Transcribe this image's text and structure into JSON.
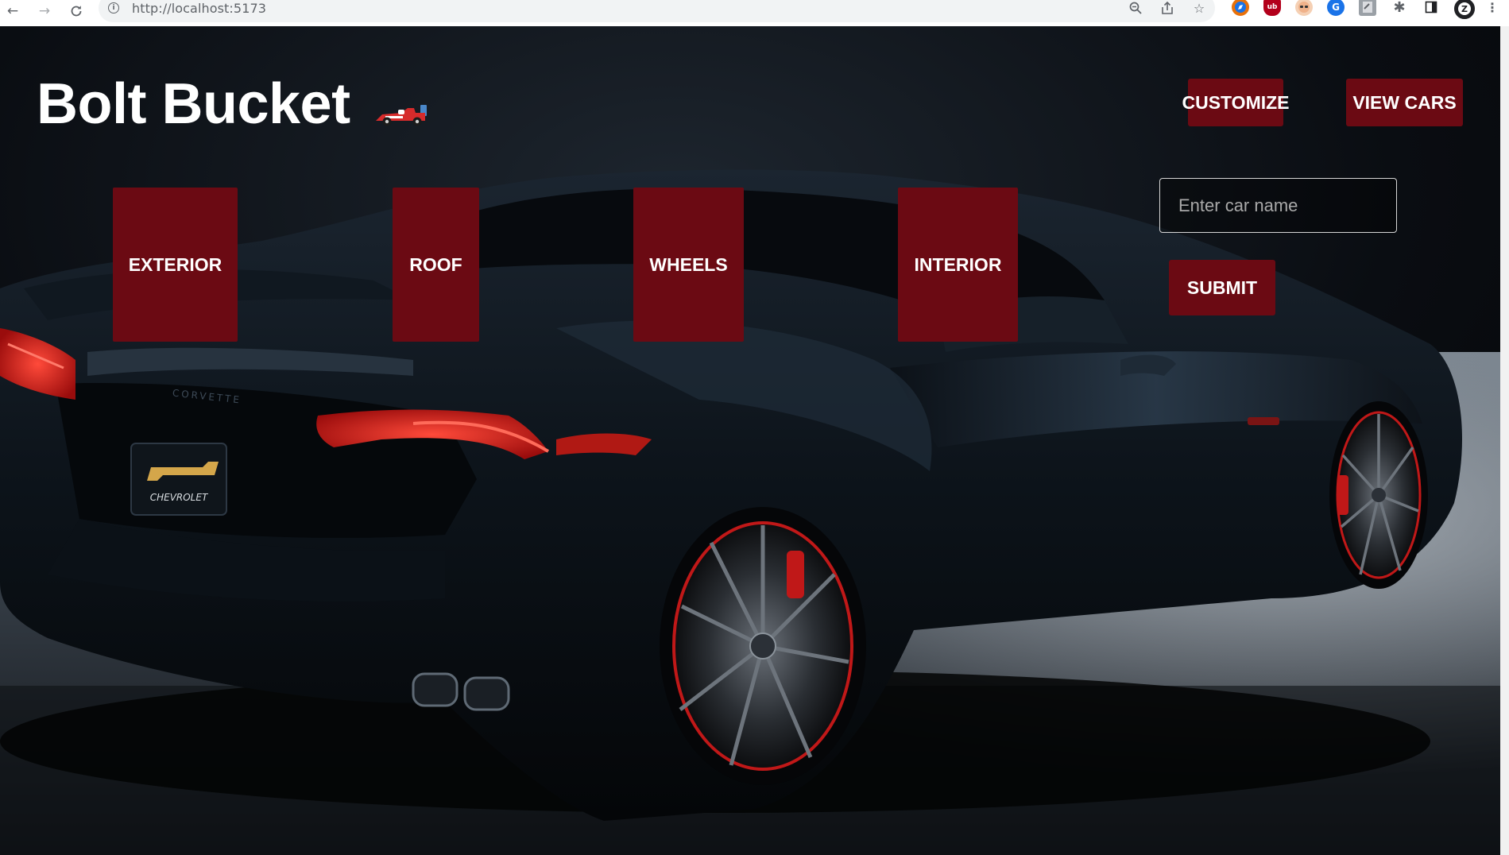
{
  "browser": {
    "url": "http://localhost:5173",
    "nav": {
      "back_icon": "arrow-left-icon",
      "forward_icon": "arrow-right-icon",
      "reload_icon": "reload-icon"
    }
  },
  "app": {
    "title": "Bolt Bucket",
    "logo_icon": "race-car-icon",
    "nav": {
      "customize": "CUSTOMIZE",
      "view_cars": "VIEW CARS"
    },
    "parts": [
      "EXTERIOR",
      "ROOF",
      "WHEELS",
      "INTERIOR"
    ],
    "form": {
      "placeholder": "Enter car name",
      "value": "",
      "submit": "SUBMIT"
    },
    "background": {
      "plate_text": "CHEVROLET",
      "emblem_text": "CORVETTE"
    }
  },
  "colors": {
    "accent": "#6b0a13",
    "text": "#ffffff",
    "page_background": "#0a0d12",
    "taillight": "#d31515"
  }
}
